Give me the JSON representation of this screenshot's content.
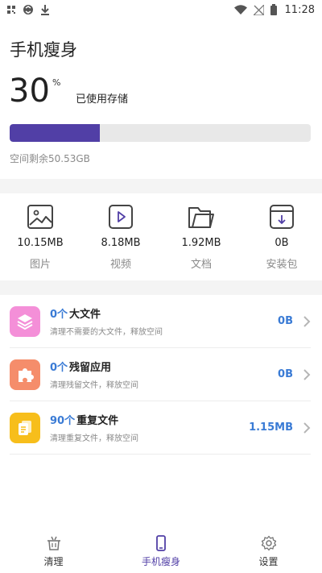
{
  "status_bar": {
    "time": "11:28",
    "left_icons": [
      "grid-icon",
      "vpn-icon",
      "download-icon"
    ],
    "right_icons": [
      "wifi-icon",
      "no-signal-icon",
      "battery-icon"
    ]
  },
  "page_title": "手机瘦身",
  "storage": {
    "percent_value": "30",
    "percent_sign": "%",
    "used_label": "已使用存储",
    "used_fraction": 0.3,
    "remaining_text": "空间剩余50.53GB",
    "bar_color": "#513fa6"
  },
  "categories": [
    {
      "icon": "image-icon",
      "size": "10.15MB",
      "name": "图片"
    },
    {
      "icon": "video-icon",
      "size": "8.18MB",
      "name": "视频"
    },
    {
      "icon": "folder-icon",
      "size": "1.92MB",
      "name": "文档"
    },
    {
      "icon": "package-icon",
      "size": "0B",
      "name": "安装包"
    }
  ],
  "rows": [
    {
      "icon": "layers-icon",
      "icon_color": "#f48fd8",
      "count": "0个",
      "name": "大文件",
      "desc": "清理不需要的大文件，释放空间",
      "size": "0B"
    },
    {
      "icon": "puzzle-icon",
      "icon_color": "#f58d6b",
      "count": "0个",
      "name": "残留应用",
      "desc": "清理残留文件，释放空间",
      "size": "0B"
    },
    {
      "icon": "files-icon",
      "icon_color": "#f7be1b",
      "count": "90个",
      "name": "重复文件",
      "desc": "清理重复文件，释放空间",
      "size": "1.15MB"
    }
  ],
  "bottom_nav": [
    {
      "icon": "basket-icon",
      "label": "清理",
      "active": false
    },
    {
      "icon": "phone-icon",
      "label": "手机瘦身",
      "active": true
    },
    {
      "icon": "gear-icon",
      "label": "设置",
      "active": false
    }
  ],
  "accent_color": "#513fa6",
  "link_color": "#3a7bd5"
}
